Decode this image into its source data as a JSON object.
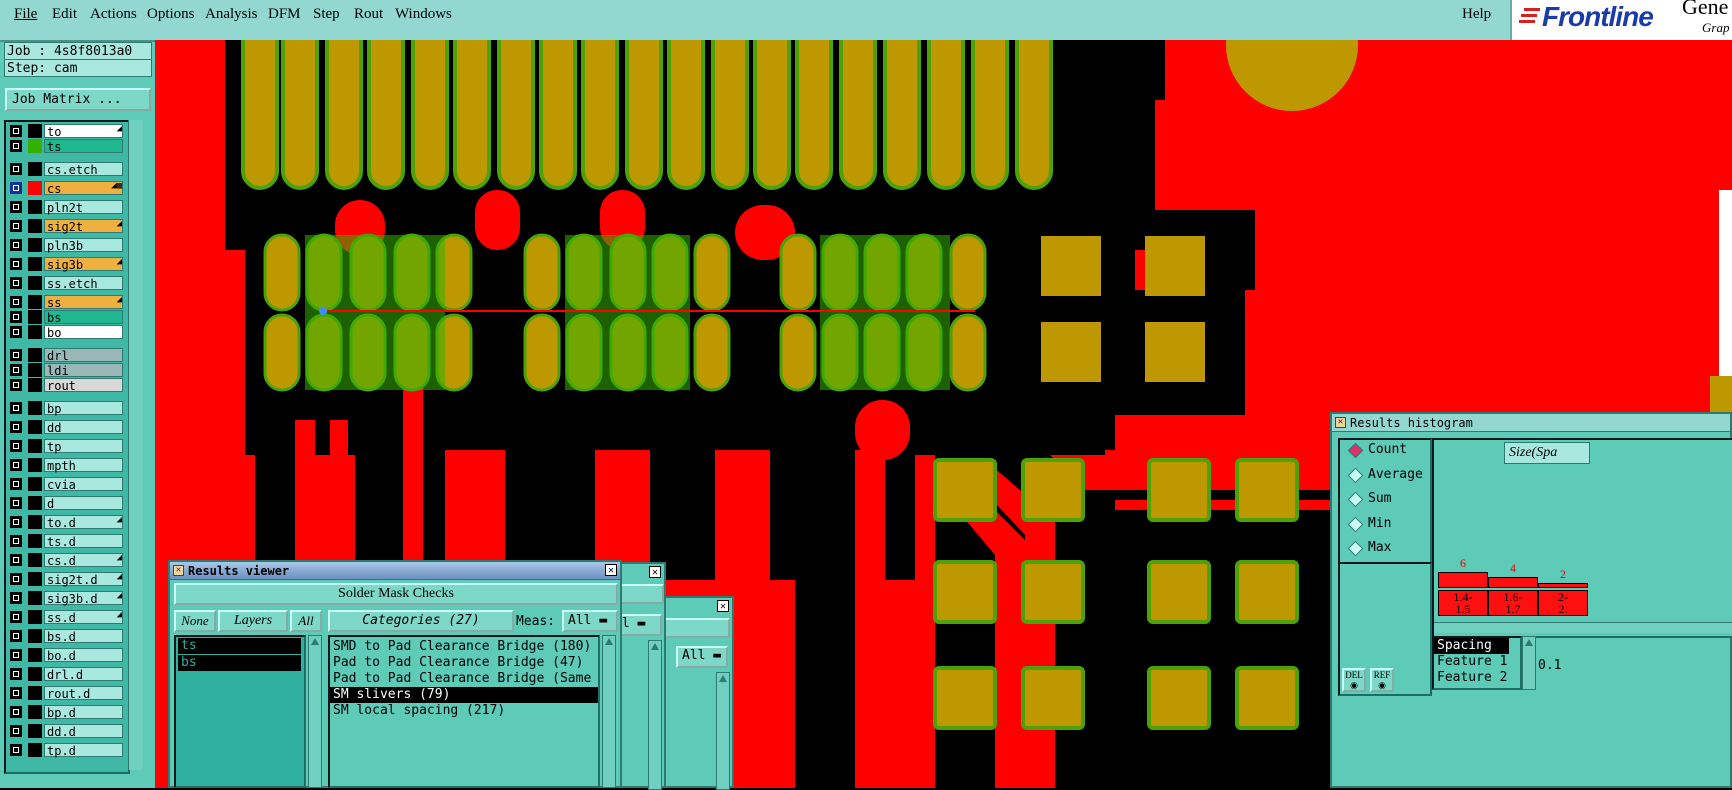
{
  "menubar": {
    "items": [
      "File",
      "Edit",
      "Actions",
      "Options",
      "Analysis",
      "DFM",
      "Step",
      "Rout",
      "Windows"
    ],
    "underline_first": true,
    "help": "Help"
  },
  "logo": {
    "brand": "Frontline",
    "product_partial": "Gene",
    "subtitle_partial": "Grap"
  },
  "job_panel": {
    "job_line": "Job : 4s8f8013a0",
    "step_line": "Step: cam",
    "matrix_button": "Job Matrix ..."
  },
  "layers": [
    {
      "name": "to",
      "swatch": "#000000",
      "bg": "#ffffff",
      "mark": "◢"
    },
    {
      "name": "ts",
      "swatch": "#35b000",
      "bg": "#20b890",
      "mark": ""
    },
    {
      "name": "cs.etch",
      "swatch": "#000000",
      "bg": "#a8e8de",
      "mark": ""
    },
    {
      "name": "cs",
      "swatch": "#ff0000",
      "bg": "#f0b040",
      "mark": "◢▦"
    },
    {
      "name": "pln2t",
      "swatch": "#000000",
      "bg": "#a8e8de",
      "mark": ""
    },
    {
      "name": "sig2t",
      "swatch": "#000000",
      "bg": "#f0b040",
      "mark": "◢"
    },
    {
      "name": "pln3b",
      "swatch": "#000000",
      "bg": "#a8e8de",
      "mark": ""
    },
    {
      "name": "sig3b",
      "swatch": "#000000",
      "bg": "#f0b040",
      "mark": "◢"
    },
    {
      "name": "ss.etch",
      "swatch": "#000000",
      "bg": "#a8e8de",
      "mark": ""
    },
    {
      "name": "ss",
      "swatch": "#000000",
      "bg": "#f0b040",
      "mark": "◢"
    },
    {
      "name": "bs",
      "swatch": "#000000",
      "bg": "#20b890",
      "mark": ""
    },
    {
      "name": "bo",
      "swatch": "#000000",
      "bg": "#ffffff",
      "mark": ""
    },
    {
      "name": "drl",
      "swatch": "#000000",
      "bg": "#9ab8b8",
      "mark": ""
    },
    {
      "name": "ldi",
      "swatch": "#000000",
      "bg": "#9ab8b8",
      "mark": ""
    },
    {
      "name": "rout",
      "swatch": "#000000",
      "bg": "#d8d8d8",
      "mark": ""
    },
    {
      "name": "bp",
      "swatch": "#000000",
      "bg": "#a8e8de",
      "mark": ""
    },
    {
      "name": "dd",
      "swatch": "#000000",
      "bg": "#a8e8de",
      "mark": ""
    },
    {
      "name": "tp",
      "swatch": "#000000",
      "bg": "#a8e8de",
      "mark": ""
    },
    {
      "name": "mpth",
      "swatch": "#000000",
      "bg": "#a8e8de",
      "mark": ""
    },
    {
      "name": "cvia",
      "swatch": "#000000",
      "bg": "#a8e8de",
      "mark": ""
    },
    {
      "name": "d",
      "swatch": "#000000",
      "bg": "#a8e8de",
      "mark": ""
    },
    {
      "name": "to.d",
      "swatch": "#000000",
      "bg": "#a8e8de",
      "mark": "◢"
    },
    {
      "name": "ts.d",
      "swatch": "#000000",
      "bg": "#a8e8de",
      "mark": ""
    },
    {
      "name": "cs.d",
      "swatch": "#000000",
      "bg": "#a8e8de",
      "mark": "◢"
    },
    {
      "name": "sig2t.d",
      "swatch": "#000000",
      "bg": "#a8e8de",
      "mark": "◢"
    },
    {
      "name": "sig3b.d",
      "swatch": "#000000",
      "bg": "#a8e8de",
      "mark": "◢"
    },
    {
      "name": "ss.d",
      "swatch": "#000000",
      "bg": "#a8e8de",
      "mark": "◢"
    },
    {
      "name": "bs.d",
      "swatch": "#000000",
      "bg": "#a8e8de",
      "mark": ""
    },
    {
      "name": "bo.d",
      "swatch": "#000000",
      "bg": "#a8e8de",
      "mark": ""
    },
    {
      "name": "drl.d",
      "swatch": "#000000",
      "bg": "#a8e8de",
      "mark": ""
    },
    {
      "name": "rout.d",
      "swatch": "#000000",
      "bg": "#a8e8de",
      "mark": ""
    },
    {
      "name": "bp.d",
      "swatch": "#000000",
      "bg": "#a8e8de",
      "mark": ""
    },
    {
      "name": "dd.d",
      "swatch": "#000000",
      "bg": "#a8e8de",
      "mark": ""
    },
    {
      "name": "tp.d",
      "swatch": "#000000",
      "bg": "#a8e8de",
      "mark": ""
    }
  ],
  "results_viewer": {
    "title": "Results viewer",
    "header": "Solder Mask Checks",
    "none_btn": "None",
    "layers_btn": "Layers",
    "all_btn": "All",
    "categories_btn": "Categories (27)",
    "meas_label": "Meas:",
    "meas_value": "All",
    "layer_items": [
      "ts",
      "bs"
    ],
    "category_items": [
      "SMD to Pad Clearance Bridge (180)",
      "Pad to Pad Clearance Bridge (47)",
      "Pad to Pad Clearance Bridge (Same",
      "SM slivers (79)",
      "SM local spacing (217)"
    ],
    "selected_category": 3
  },
  "back_dialog_1": {
    "meas_value": "ll"
  },
  "back_dialog_2": {
    "meas_value": "All"
  },
  "histogram": {
    "title": "Results histogram",
    "modes": [
      "Count",
      "Average",
      "Sum",
      "Min",
      "Max"
    ],
    "selected_mode": 0,
    "size_label": "Size(Spa",
    "del_btn": "DEL",
    "ref_btn": "REF",
    "fields": [
      "Spacing",
      "Feature 1",
      "Feature 2"
    ],
    "value_partial": "0.1",
    "bars": [
      {
        "count": 6,
        "label_top": "1.4-",
        "label_bottom": "1.5"
      },
      {
        "count": 4,
        "label_top": "1.6-",
        "label_bottom": "1.7"
      },
      {
        "count": 2,
        "label_top": "2-",
        "label_bottom": "2."
      }
    ]
  },
  "colors": {
    "copper": "#ff0000",
    "pad": "#bd9800",
    "mask": "#4da20a",
    "background": "#000000",
    "panel": "#5ecab8"
  }
}
